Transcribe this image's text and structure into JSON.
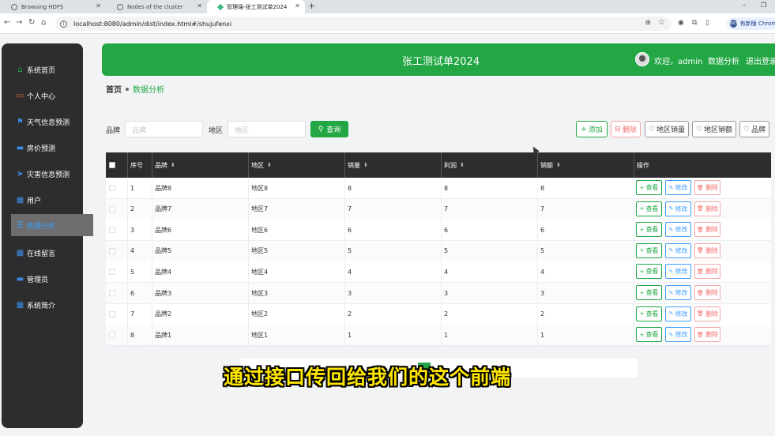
{
  "browser": {
    "tabs": [
      {
        "title": "Browsing HDFS"
      },
      {
        "title": "Nodes of the cluster"
      },
      {
        "title": "管理端-张工测试单2024"
      }
    ],
    "url": "localhost:8080/admin/dist/index.html#/shujufenxi",
    "profile_label": "有新版 Chrome 可"
  },
  "header": {
    "title": "张工测试单2024",
    "welcome": "欢迎，admin",
    "links": [
      "数据分析",
      "退出登录"
    ]
  },
  "sidebar": {
    "items": [
      {
        "label": "系统首页",
        "icon": "home-icon",
        "active": false
      },
      {
        "label": "个人中心",
        "icon": "card-icon",
        "active": false
      },
      {
        "label": "天气信息预测",
        "icon": "flag-icon",
        "active": false
      },
      {
        "label": "房价预测",
        "icon": "monitor-icon",
        "active": false
      },
      {
        "label": "灾害信息预测",
        "icon": "send-icon",
        "active": false
      },
      {
        "label": "用户",
        "icon": "grid-icon",
        "active": false
      },
      {
        "label": "数据分析",
        "icon": "list-icon",
        "active": true
      },
      {
        "label": "在线留言",
        "icon": "grid-icon",
        "active": false
      },
      {
        "label": "管理员",
        "icon": "monitor-icon",
        "active": false
      },
      {
        "label": "系统简介",
        "icon": "grid-icon",
        "active": false
      }
    ]
  },
  "breadcrumb": {
    "home": "首页",
    "current": "数据分析"
  },
  "search": {
    "brand_label": "品牌",
    "brand_placeholder": "品牌",
    "region_label": "地区",
    "region_placeholder": "地区",
    "button": "查询"
  },
  "toolbar": {
    "add": "添加",
    "delete": "删除",
    "region_sales": "地区销量",
    "region_revenue": "地区销额",
    "brand": "品牌"
  },
  "table": {
    "columns": [
      "序号",
      "品牌",
      "地区",
      "销量",
      "利润",
      "销额",
      "操作"
    ],
    "rows": [
      [
        "1",
        "品牌8",
        "地区8",
        "8",
        "8",
        "8"
      ],
      [
        "2",
        "品牌7",
        "地区7",
        "7",
        "7",
        "7"
      ],
      [
        "3",
        "品牌6",
        "地区6",
        "6",
        "6",
        "6"
      ],
      [
        "4",
        "品牌5",
        "地区5",
        "5",
        "5",
        "5"
      ],
      [
        "5",
        "品牌4",
        "地区4",
        "4",
        "4",
        "4"
      ],
      [
        "6",
        "品牌3",
        "地区3",
        "3",
        "3",
        "3"
      ],
      [
        "7",
        "品牌2",
        "地区2",
        "2",
        "2",
        "2"
      ],
      [
        "8",
        "品牌1",
        "地区1",
        "1",
        "1",
        "1"
      ]
    ],
    "actions": {
      "view": "查看",
      "edit": "修改",
      "delete": "删除"
    }
  },
  "subtitle": "通过接口传回给我们的这个前端",
  "colors": {
    "primary": "#22a744",
    "sidebar": "#2d2d2f",
    "active_text": "#3a9ff5",
    "edit": "#409eff",
    "danger": "#f56c6c"
  }
}
